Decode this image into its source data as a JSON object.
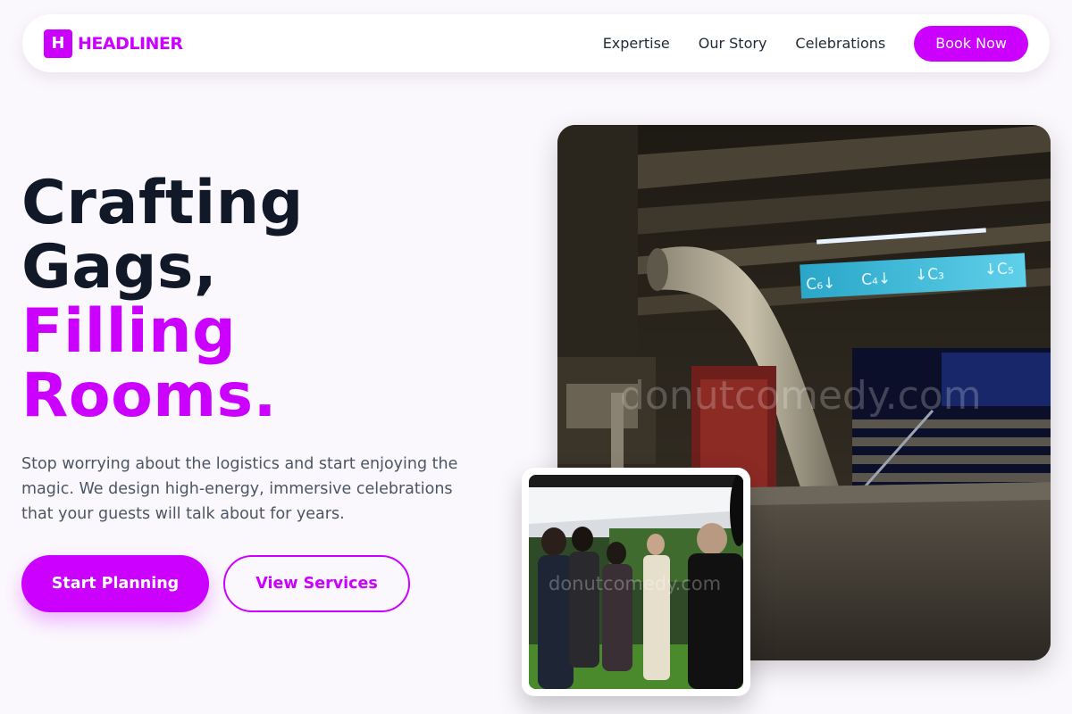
{
  "nav": {
    "logo_mark": "H",
    "logo_text": "HEADLINER",
    "links": [
      "Expertise",
      "Our Story",
      "Celebrations"
    ],
    "cta": "Book Now"
  },
  "hero": {
    "title_line1": "Crafting",
    "title_line2": "Gags,",
    "title_line3": "Filling",
    "title_line4": "Rooms.",
    "description": "Stop worrying about the logistics and start enjoying the magic. We design high-energy, immersive celebrations that your guests will talk about for years.",
    "primary_button": "Start Planning",
    "secondary_button": "View Services"
  },
  "images": {
    "main_watermark": "donutcomedy.com",
    "inset_watermark": "donutcomedy.com",
    "signage": [
      "C₆↓",
      "C₄↓",
      "↓C₃",
      "↓C₅"
    ]
  },
  "colors": {
    "accent": "#cc00ff",
    "heading": "#111827",
    "body_text": "#4b5563",
    "background": "#fbf8fd"
  }
}
